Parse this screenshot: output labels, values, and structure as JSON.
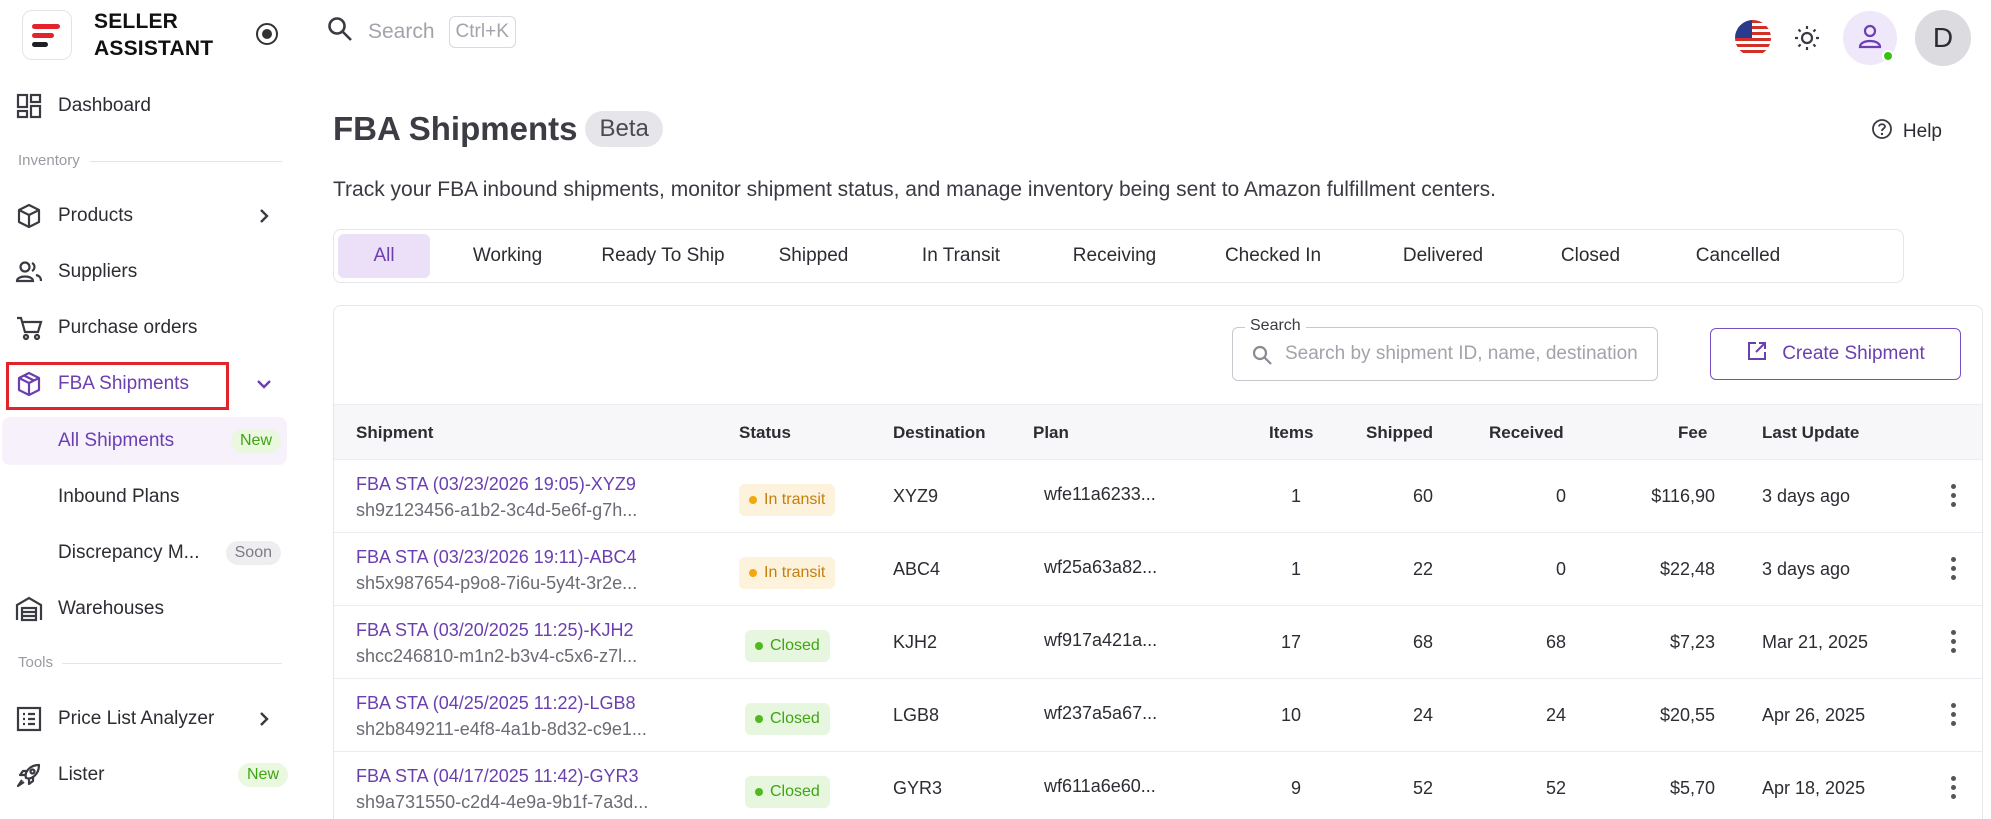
{
  "brand": {
    "name_line1": "SELLER",
    "name_line2": "ASSISTANT",
    "logo_colors": [
      "#e3232b",
      "#e3232b",
      "#1f1f24"
    ]
  },
  "header": {
    "search_placeholder": "Search",
    "search_shortcut": "Ctrl+K",
    "avatar_letter": "D"
  },
  "sidebar": {
    "dashboard": "Dashboard",
    "section_inventory": "Inventory",
    "products": "Products",
    "suppliers": "Suppliers",
    "purchase_orders": "Purchase orders",
    "fba_shipments": "FBA Shipments",
    "sub_items": [
      {
        "label": "All Shipments",
        "badge": "New"
      },
      {
        "label": "Inbound Plans",
        "badge": ""
      },
      {
        "label": "Discrepancy M...",
        "badge": "Soon"
      }
    ],
    "warehouses": "Warehouses",
    "section_tools": "Tools",
    "price_list_analyzer": "Price List Analyzer",
    "lister": "Lister",
    "lister_badge": "New"
  },
  "main": {
    "title": "FBA Shipments",
    "title_badge": "Beta",
    "help_label": "Help",
    "subtitle": "Track your FBA inbound shipments, monitor shipment status, and manage inventory being sent to Amazon fulfillment centers.",
    "tabs": [
      "All",
      "Working",
      "Ready To Ship",
      "Shipped",
      "In Transit",
      "Receiving",
      "Checked In",
      "Delivered",
      "Closed",
      "Cancelled"
    ],
    "active_tab": "All",
    "search_legend": "Search",
    "search_placeholder": "Search by shipment ID, name, destination",
    "create_button": "Create Shipment"
  },
  "table": {
    "columns": [
      "Shipment",
      "Status",
      "Destination",
      "Plan",
      "Items",
      "Shipped",
      "Received",
      "Fee",
      "Last Update"
    ],
    "rows": [
      {
        "name": "FBA STA (03/23/2026 19:05)-XYZ9",
        "id": "sh9z123456-a1b2-3c4d-5e6f-g7h...",
        "status": "In transit",
        "destination": "XYZ9",
        "plan": "wfe11a6233...",
        "items": "1",
        "shipped": "60",
        "received": "0",
        "fee": "$116,90",
        "last_update": "3 days ago"
      },
      {
        "name": "FBA STA (03/23/2026 19:11)-ABC4",
        "id": "sh5x987654-p9o8-7i6u-5y4t-3r2e...",
        "status": "In transit",
        "destination": "ABC4",
        "plan": "wf25a63a82...",
        "items": "1",
        "shipped": "22",
        "received": "0",
        "fee": "$22,48",
        "last_update": "3 days ago"
      },
      {
        "name": "FBA STA (03/20/2025 11:25)-KJH2",
        "id": "shcc246810-m1n2-b3v4-c5x6-z7l...",
        "status": "Closed",
        "destination": "KJH2",
        "plan": "wf917a421a...",
        "items": "17",
        "shipped": "68",
        "received": "68",
        "fee": "$7,23",
        "last_update": "Mar 21, 2025"
      },
      {
        "name": "FBA STA (04/25/2025 11:22)-LGB8",
        "id": "sh2b849211-e4f8-4a1b-8d32-c9e1...",
        "status": "Closed",
        "destination": "LGB8",
        "plan": "wf237a5a67...",
        "items": "10",
        "shipped": "24",
        "received": "24",
        "fee": "$20,55",
        "last_update": "Apr 26, 2025"
      },
      {
        "name": "FBA STA (04/17/2025 11:42)-GYR3",
        "id": "sh9a731550-c2d4-4e9a-9b1f-7a3d...",
        "status": "Closed",
        "destination": "GYR3",
        "plan": "wf611a6e60...",
        "items": "9",
        "shipped": "52",
        "received": "52",
        "fee": "$5,70",
        "last_update": "Apr 18, 2025"
      }
    ]
  },
  "icons": {
    "brand_toggle": "radio-toggle-icon",
    "search": "search-icon",
    "flag": "us-flag-icon",
    "theme": "sun-icon",
    "user": "user-icon",
    "help": "help-circle-icon",
    "create": "external-link-icon",
    "row_menu": "more-vertical-icon"
  },
  "colors": {
    "accent": "#6b3fb0",
    "highlight_box": "#e3232b",
    "status_in_transit": "#f0a90e",
    "status_closed": "#52b81e",
    "badge_new": "#3fa512"
  }
}
